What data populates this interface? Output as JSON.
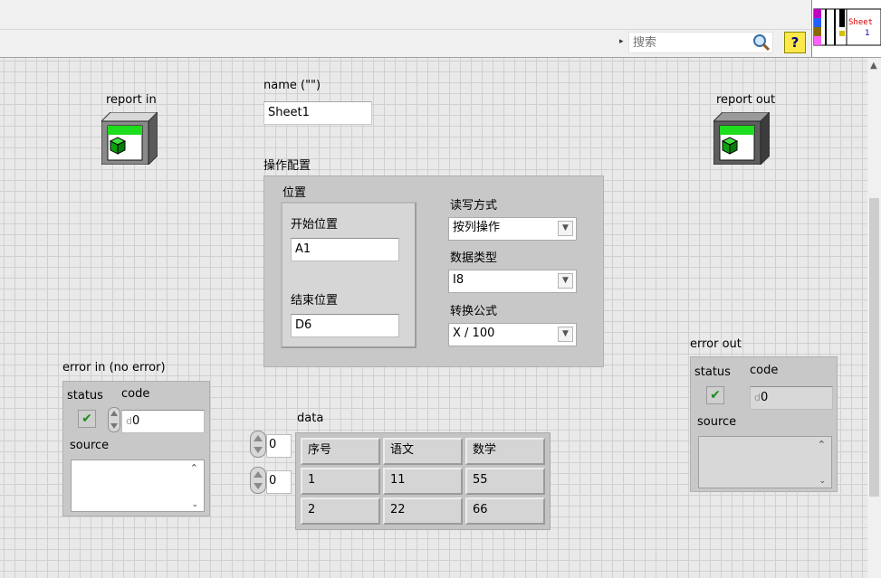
{
  "toolbar": {
    "search_placeholder": "搜索",
    "help_label": "?"
  },
  "vi_icon": {
    "text_line1": "Sheet",
    "text_line2": "1"
  },
  "report_in": {
    "label": "report in"
  },
  "report_out": {
    "label": "report out"
  },
  "name_control": {
    "label": "name (\"\")",
    "value": "Sheet1"
  },
  "config": {
    "label": "操作配置",
    "position_group": {
      "label": "位置",
      "start_label": "开始位置",
      "start_value": "A1",
      "end_label": "结束位置",
      "end_value": "D6"
    },
    "rw_mode": {
      "label": "读写方式",
      "value": "按列操作"
    },
    "data_type": {
      "label": "数据类型",
      "value": "I8"
    },
    "formula": {
      "label": "转换公式",
      "value": "X / 100"
    }
  },
  "error_in": {
    "label": "error in (no error)",
    "status_label": "status",
    "code_label": "code",
    "code_value": "0",
    "code_prefix": "d",
    "source_label": "source",
    "status_check": "✔"
  },
  "error_out": {
    "label": "error out",
    "status_label": "status",
    "code_label": "code",
    "code_value": "0",
    "code_prefix": "d",
    "source_label": "source",
    "status_check": "✔"
  },
  "data_table": {
    "label": "data",
    "row_index": "0",
    "col_index": "0",
    "rows": [
      [
        "序号",
        "语文",
        "数学"
      ],
      [
        "1",
        "11",
        "55"
      ],
      [
        "2",
        "22",
        "66"
      ]
    ]
  },
  "colors": {
    "panel_grid": "#e9e9e9",
    "refnum_green": "#1edc1e",
    "help_yellow": "#ffe84a"
  }
}
